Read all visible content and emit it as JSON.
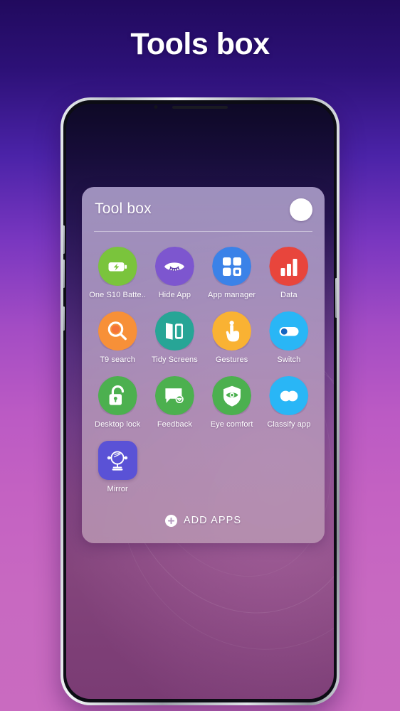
{
  "page": {
    "title": "Tools box"
  },
  "phone": {
    "speaker_name": "earpiece-speaker"
  },
  "panel": {
    "title": "Tool box",
    "avatar_name": "profile-avatar-button",
    "apps": [
      {
        "label": "One S10 Batte..",
        "icon": "battery-charging-icon",
        "color": "#7ac43c",
        "shape": "squircle"
      },
      {
        "label": "Hide App",
        "icon": "closed-eye-icon",
        "color": "#7d56cf",
        "shape": "squircle"
      },
      {
        "label": "App manager",
        "icon": "grid-apps-icon",
        "color": "#3b82e8",
        "shape": "squircle"
      },
      {
        "label": "Data",
        "icon": "bar-chart-icon",
        "color": "#e8453c",
        "shape": "squircle"
      },
      {
        "label": "T9 search",
        "icon": "search-icon",
        "color": "#f79038",
        "shape": "squircle"
      },
      {
        "label": "Tidy Screens",
        "icon": "two-panels-icon",
        "color": "#27a596",
        "shape": "squircle"
      },
      {
        "label": "Gestures",
        "icon": "hand-tap-icon",
        "color": "#f9b233",
        "shape": "squircle"
      },
      {
        "label": "Switch",
        "icon": "toggle-switch-icon",
        "color": "#29b6f6",
        "shape": "squircle"
      },
      {
        "label": "Desktop lock",
        "icon": "padlock-icon",
        "color": "#4cb04f",
        "shape": "squircle"
      },
      {
        "label": "Feedback",
        "icon": "speech-bubble-icon",
        "color": "#4cb04f",
        "shape": "squircle"
      },
      {
        "label": "Eye comfort",
        "icon": "shield-eye-icon",
        "color": "#4cb04f",
        "shape": "squircle"
      },
      {
        "label": "Classify app",
        "icon": "overlapping-circles-icon",
        "color": "#29b6f6",
        "shape": "squircle"
      },
      {
        "label": "Mirror",
        "icon": "vanity-mirror-icon",
        "color": "#5a52d6",
        "shape": "rounded-sq"
      }
    ],
    "add_apps": {
      "label": "ADD APPS",
      "icon": "plus-circle-icon"
    }
  },
  "colors": {
    "background_top": "#210a5e",
    "background_bottom": "#c96bc0",
    "panel_tint": "#b4a6d1",
    "title_text": "#ffffff"
  }
}
